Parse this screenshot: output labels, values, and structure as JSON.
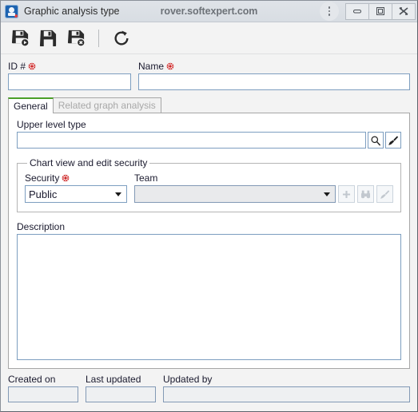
{
  "window": {
    "title": "Graphic analysis type",
    "host": "rover.softexpert.com",
    "app_icon": "softexpert-logo-icon",
    "controls": {
      "menu": "more-options-kebab",
      "minimize": "minimize",
      "maximize": "maximize",
      "close": "close"
    }
  },
  "toolbar": {
    "buttons": [
      {
        "name": "save-and-new-button",
        "icon": "save-new-icon",
        "title": "Save and new"
      },
      {
        "name": "save-button",
        "icon": "save-icon",
        "title": "Save"
      },
      {
        "name": "save-and-exit-button",
        "icon": "save-exit-icon",
        "title": "Save and exit"
      },
      {
        "name": "refresh-button",
        "icon": "refresh-icon",
        "title": "Refresh"
      }
    ]
  },
  "form": {
    "id": {
      "label": "ID #",
      "value": "",
      "required": true
    },
    "name": {
      "label": "Name",
      "value": "",
      "required": true
    },
    "upper_level_type": {
      "label": "Upper level type",
      "value": ""
    },
    "security_group": {
      "legend": "Chart view and edit security",
      "security": {
        "label": "Security",
        "value": "Public",
        "required": true
      },
      "team": {
        "label": "Team",
        "value": "",
        "required": false,
        "disabled": true
      }
    },
    "description": {
      "label": "Description",
      "value": ""
    }
  },
  "tabs": [
    {
      "label": "General",
      "active": true
    },
    {
      "label": "Related graph analysis",
      "active": false
    }
  ],
  "footer": {
    "created_on": {
      "label": "Created on",
      "value": ""
    },
    "last_updated": {
      "label": "Last updated",
      "value": ""
    },
    "updated_by": {
      "label": "Updated by",
      "value": ""
    }
  },
  "colors": {
    "active_tab_accent": "#4b9f28",
    "required_marker": "#cc2222",
    "field_border": "#7d9ec0",
    "window_chrome": "#dfe3e8"
  }
}
